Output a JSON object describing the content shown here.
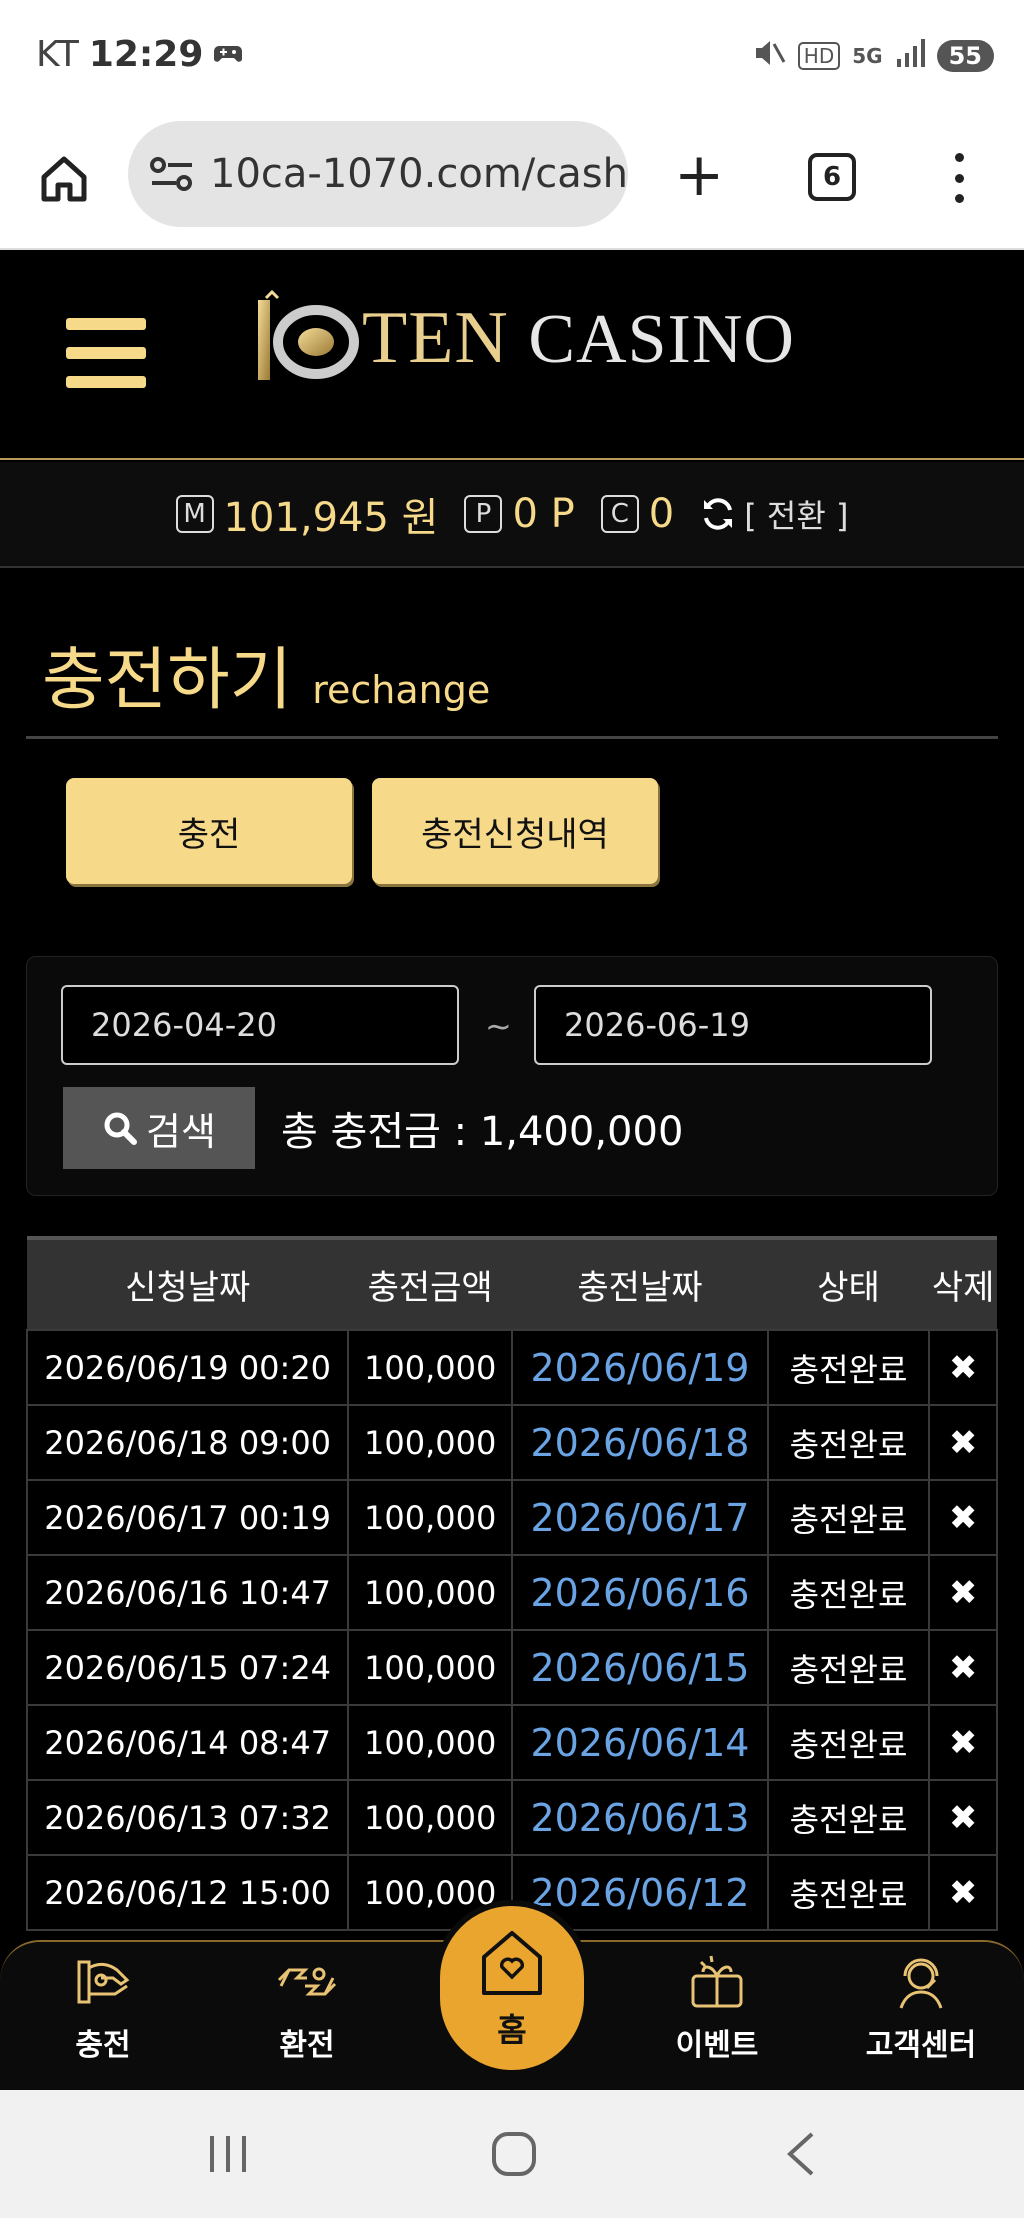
{
  "status_bar": {
    "carrier": "KT",
    "time": "12:29",
    "network": "5G",
    "hd": "HD",
    "battery": "55"
  },
  "browser": {
    "url": "10ca-1070.com/cash",
    "tab_count": "6"
  },
  "header": {
    "logo_ten": "Ten",
    "logo_casino": "Casino"
  },
  "balance": {
    "money_icon": "M",
    "money_value": "101,945 원",
    "point_icon": "P",
    "point_value": "0 P",
    "coin_icon": "C",
    "coin_value": "0",
    "switch_label": "[ 전환 ]"
  },
  "page": {
    "title_ko": "충전하기",
    "title_en": "rechange",
    "tab_charge": "충전",
    "tab_history": "충전신청내역"
  },
  "search": {
    "date_from": "2026-04-20",
    "tilde": "~",
    "date_to": "2026-06-19",
    "button_label": "검색",
    "total_label": "총 충전금 : 1,400,000"
  },
  "table": {
    "headers": [
      "신청날짜",
      "충전금액",
      "충전날짜",
      "상태",
      "삭제"
    ],
    "rows": [
      [
        "2026/06/19 00:20",
        "100,000",
        "2026/06/19",
        "충전완료",
        "✖"
      ],
      [
        "2026/06/18 09:00",
        "100,000",
        "2026/06/18",
        "충전완료",
        "✖"
      ],
      [
        "2026/06/17 00:19",
        "100,000",
        "2026/06/17",
        "충전완료",
        "✖"
      ],
      [
        "2026/06/16 10:47",
        "100,000",
        "2026/06/16",
        "충전완료",
        "✖"
      ],
      [
        "2026/06/15 07:24",
        "100,000",
        "2026/06/15",
        "충전완료",
        "✖"
      ],
      [
        "2026/06/14 08:47",
        "100,000",
        "2026/06/14",
        "충전완료",
        "✖"
      ],
      [
        "2026/06/13 07:32",
        "100,000",
        "2026/06/13",
        "충전완료",
        "✖"
      ],
      [
        "2026/06/12 15:00",
        "100,000",
        "2026/06/12",
        "충전완료",
        "✖"
      ]
    ]
  },
  "bottom_nav": {
    "charge": "충전",
    "exchange": "환전",
    "home": "홈",
    "event": "이벤트",
    "support": "고객센터"
  },
  "colors": {
    "gold": "#f7d98a",
    "link_blue": "#6aa4e4",
    "home_orange": "#e9a52e"
  }
}
